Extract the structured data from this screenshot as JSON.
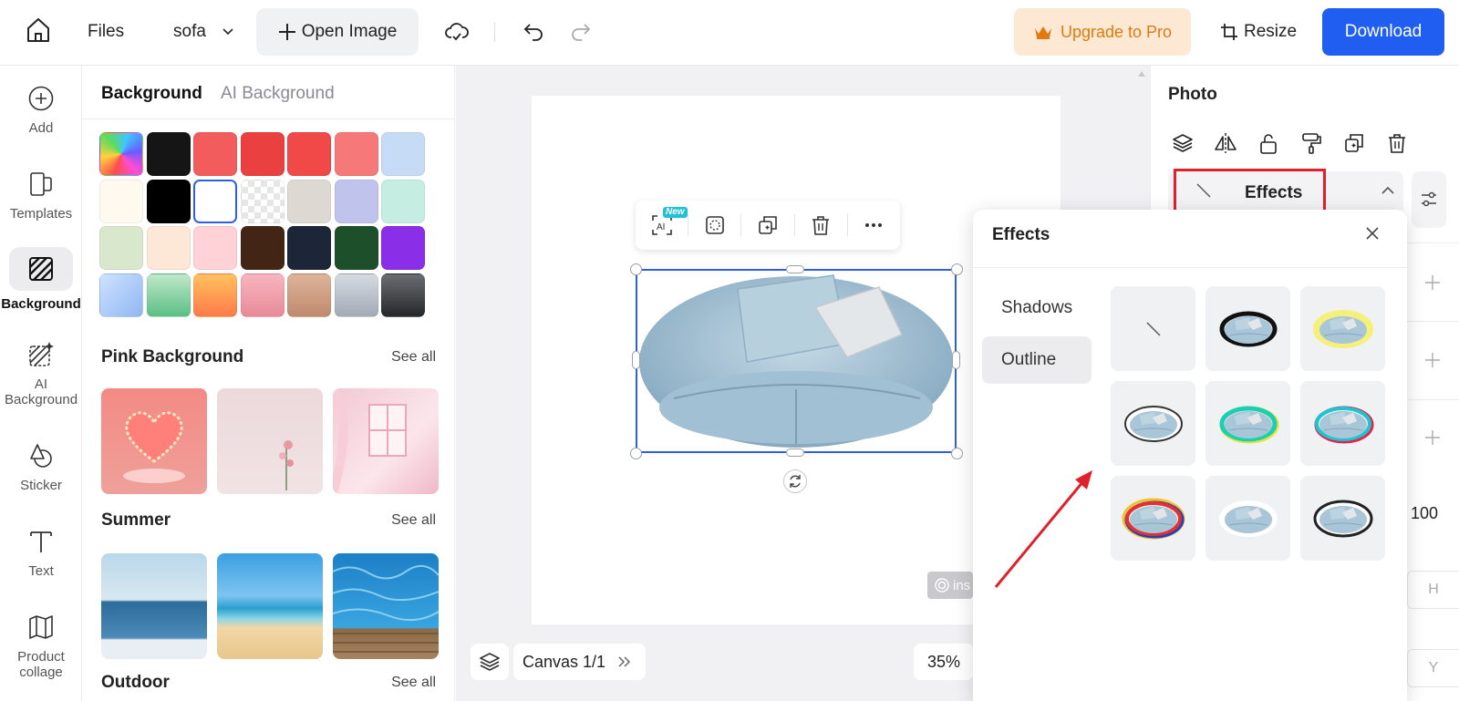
{
  "topbar": {
    "files_label": "Files",
    "filename": "sofa",
    "open_image_label": "Open Image",
    "upgrade_label": "Upgrade to Pro",
    "resize_label": "Resize",
    "download_label": "Download"
  },
  "leftnav": {
    "items": [
      {
        "label": "Add",
        "icon": "plus-circle-icon"
      },
      {
        "label": "Templates",
        "icon": "templates-icon"
      },
      {
        "label": "Background",
        "icon": "background-icon"
      },
      {
        "label": "AI Background",
        "icon": "ai-background-icon"
      },
      {
        "label": "Sticker",
        "icon": "sticker-icon"
      },
      {
        "label": "Text",
        "icon": "text-icon"
      },
      {
        "label": "Product collage",
        "icon": "collage-icon"
      }
    ],
    "active": "Background"
  },
  "bgpanel": {
    "tabs": [
      "Background",
      "AI Background"
    ],
    "swatch_rows": [
      [
        "rainbow",
        "#151515",
        "#f25c5c",
        "#eb4040",
        "#f14848",
        "#f77878",
        "#c6dbf6"
      ],
      [
        "#fff9f0",
        "#000000",
        "#ffffff",
        "transparent",
        "#ddd9d2",
        "#c0c3ec",
        "#c6ede2"
      ],
      [
        "#d9e8cc",
        "#fde8d8",
        "#fed2d7",
        "#432516",
        "#1c2638",
        "#1d4f2b",
        "#8a2ee8"
      ],
      [
        "grad-blue",
        "grad-green",
        "grad-orange",
        "grad-pink",
        "grad-tan",
        "grad-silver",
        "grad-dark"
      ]
    ],
    "selected_swatch": "#ffffff",
    "sections": [
      {
        "title": "Pink Background",
        "see_all": "See all"
      },
      {
        "title": "Summer",
        "see_all": "See all"
      },
      {
        "title": "Outdoor",
        "see_all": "See all"
      }
    ]
  },
  "canvas": {
    "canvas_label": "Canvas 1/1",
    "zoom": "35%",
    "new_badge": "New",
    "ai_badge": "AI",
    "watermark": "ins"
  },
  "rightpanel": {
    "title": "Photo",
    "effects_label": "Effects",
    "opacity_value": "100",
    "h_label": "H",
    "y_label": "Y"
  },
  "effects_popup": {
    "title": "Effects",
    "tabs": [
      "Shadows",
      "Outline"
    ],
    "active_tab": "Outline",
    "options": [
      "none",
      "black-outline",
      "yellow-glow",
      "thin-outline",
      "multicolor-outline",
      "cyan-red-outline",
      "rainbow-outline",
      "white-outline",
      "dark-outline"
    ]
  },
  "colors": {
    "accent": "#1f5ef0",
    "upgrade_bg": "#fde9d3",
    "upgrade_text": "#e07a10",
    "highlight_red": "#e0202a",
    "sofa": "#a9c6d8"
  }
}
